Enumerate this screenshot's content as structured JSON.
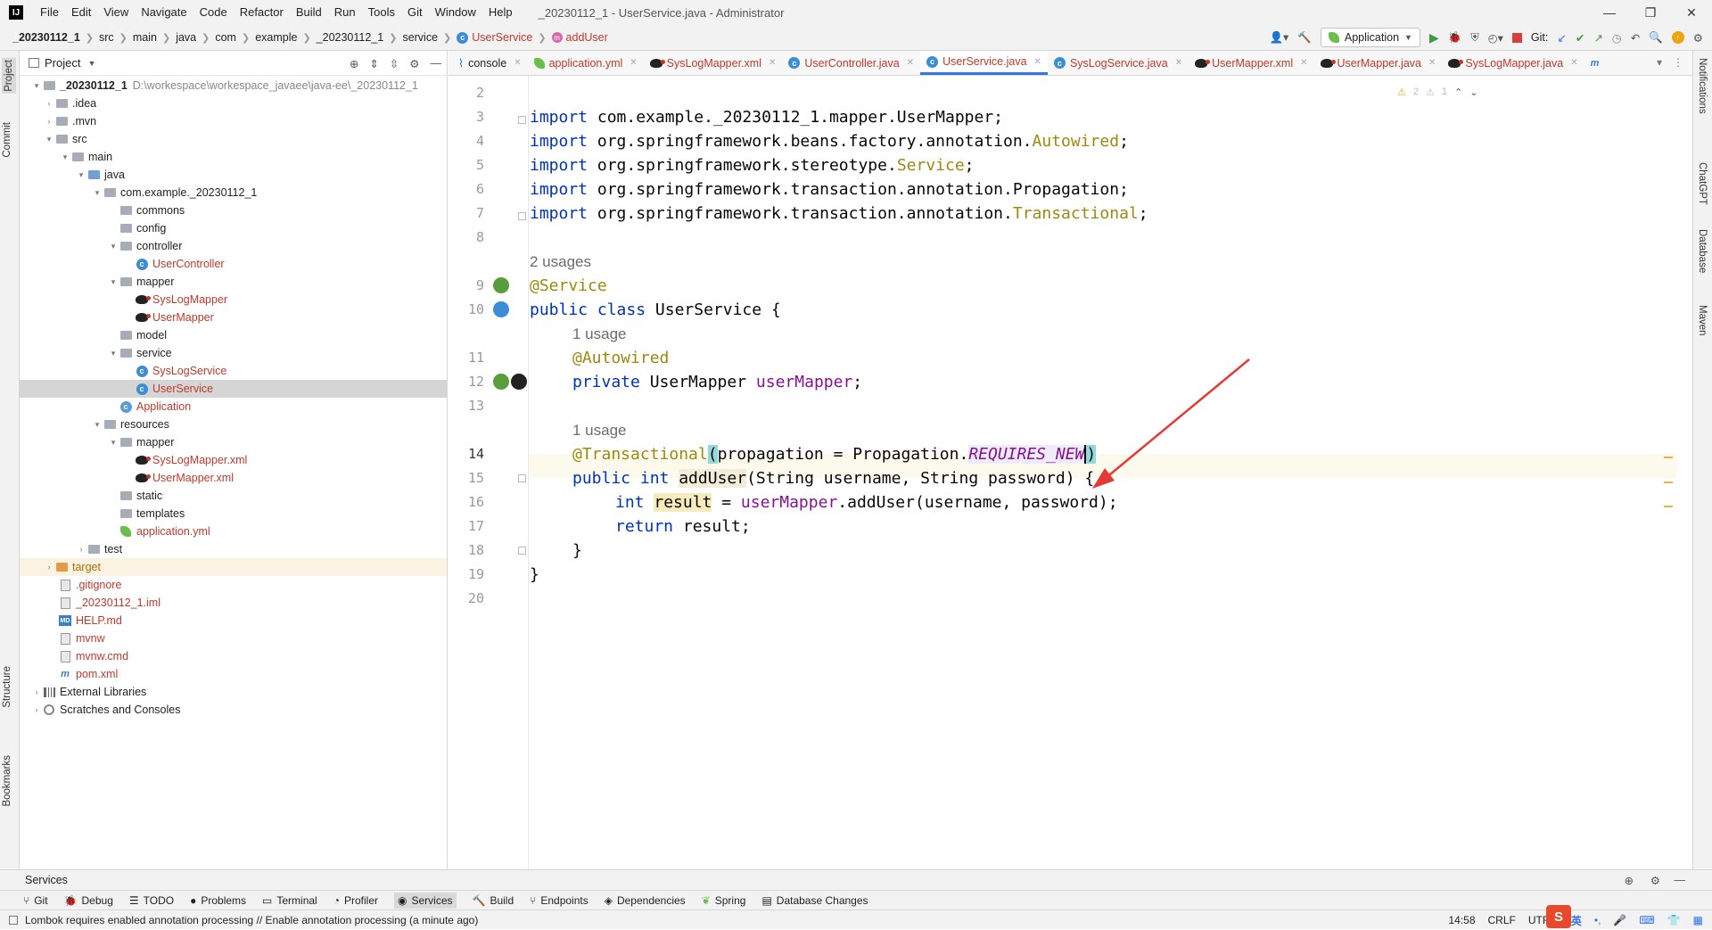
{
  "menubar": {
    "logo": "IJ",
    "items": [
      "File",
      "Edit",
      "View",
      "Navigate",
      "Code",
      "Refactor",
      "Build",
      "Run",
      "Tools",
      "Git",
      "Window",
      "Help"
    ],
    "window_title": "_20230112_1 - UserService.java - Administrator",
    "min": "—",
    "max": "❐",
    "close": "✕"
  },
  "breadcrumb": [
    "_20230112_1",
    "src",
    "main",
    "java",
    "com",
    "example",
    "_20230112_1",
    "service",
    "UserService",
    "addUser"
  ],
  "run_config": "Application",
  "git_label": "Git:",
  "project_panel": {
    "title": "Project",
    "root": "_20230112_1",
    "root_path": "D:\\workespace\\workespace_javaee\\java-ee\\_20230112_1",
    "nodes": [
      {
        "label": ".idea"
      },
      {
        "label": ".mvn"
      },
      {
        "label": "src"
      },
      {
        "label": "main"
      },
      {
        "label": "java"
      },
      {
        "label": "com.example._20230112_1"
      },
      {
        "label": "commons"
      },
      {
        "label": "config"
      },
      {
        "label": "controller"
      },
      {
        "label": "UserController"
      },
      {
        "label": "mapper"
      },
      {
        "label": "SysLogMapper"
      },
      {
        "label": "UserMapper"
      },
      {
        "label": "model"
      },
      {
        "label": "service"
      },
      {
        "label": "SysLogService"
      },
      {
        "label": "UserService"
      },
      {
        "label": "Application"
      },
      {
        "label": "resources"
      },
      {
        "label": "mapper"
      },
      {
        "label": "SysLogMapper.xml"
      },
      {
        "label": "UserMapper.xml"
      },
      {
        "label": "static"
      },
      {
        "label": "templates"
      },
      {
        "label": "application.yml"
      },
      {
        "label": "test"
      },
      {
        "label": "target"
      },
      {
        "label": ".gitignore"
      },
      {
        "label": "_20230112_1.iml"
      },
      {
        "label": "HELP.md"
      },
      {
        "label": "mvnw"
      },
      {
        "label": "mvnw.cmd"
      },
      {
        "label": "pom.xml"
      },
      {
        "label": "External Libraries"
      },
      {
        "label": "Scratches and Consoles"
      }
    ]
  },
  "editor_tabs": [
    "console",
    "application.yml",
    "SysLogMapper.xml",
    "UserController.java",
    "UserService.java",
    "SysLogService.java",
    "UserMapper.xml",
    "UserMapper.java",
    "SysLogMapper.java"
  ],
  "inspections": {
    "warnings": "2",
    "weak": "1"
  },
  "code": {
    "line_numbers": [
      "2",
      "3",
      "4",
      "5",
      "6",
      "7",
      "8",
      "9",
      "10",
      "11",
      "12",
      "13",
      "14",
      "15",
      "16",
      "17",
      "18",
      "19",
      "20"
    ],
    "l3a": "import ",
    "l3b": "com.example._20230112_1.mapper.UserMapper;",
    "l4a": "import ",
    "l4b": "org.springframework.beans.factory.annotation.",
    "l4c": "Autowired",
    "l4d": ";",
    "l5a": "import ",
    "l5b": "org.springframework.stereotype.",
    "l5c": "Service",
    "l5d": ";",
    "l6a": "import ",
    "l6b": "org.springframework.transaction.annotation.Propagation;",
    "l7a": "import ",
    "l7b": "org.springframework.transaction.annotation.",
    "l7c": "Transactional",
    "l7d": ";",
    "usages2": "2 usages",
    "l9": "@Service",
    "l10a": "public class ",
    "l10b": "UserService {",
    "usage1a": "1 usage",
    "l11": "@Autowired",
    "l12a": "private ",
    "l12b": "UserMapper ",
    "l12c": "userMapper",
    "l12d": ";",
    "usage1b": "1 usage",
    "l14a": "@Transactional",
    "l14b": "(",
    "l14c": "propagation = Propagation.",
    "l14d": "REQUIRES_NEW",
    "l14e": ")",
    "l15a": "public int ",
    "l15b": "addUser",
    "l15c": "(String username, String password) {",
    "l16a": "int ",
    "l16b": "result",
    "l16c": " = ",
    "l16d": "userMapper",
    "l16e": ".addUser(username, password);",
    "l17a": "return ",
    "l17b": "result;",
    "l18": "}",
    "l19": "}"
  },
  "left_tool_tabs": [
    "Project",
    "Commit",
    "Structure",
    "Bookmarks"
  ],
  "right_tool_tabs": [
    "Notifications",
    "ChatGPT",
    "Database",
    "Maven"
  ],
  "services_title": "Services",
  "tool_windows": [
    "Git",
    "Debug",
    "TODO",
    "Problems",
    "Terminal",
    "Profiler",
    "Services",
    "Build",
    "Endpoints",
    "Dependencies",
    "Spring",
    "Database Changes"
  ],
  "status": {
    "message": "Lombok requires enabled annotation processing // Enable annotation processing (a minute ago)",
    "position": "14:58",
    "line_sep": "CRLF",
    "encoding": "UTF-8",
    "ime": "英"
  }
}
